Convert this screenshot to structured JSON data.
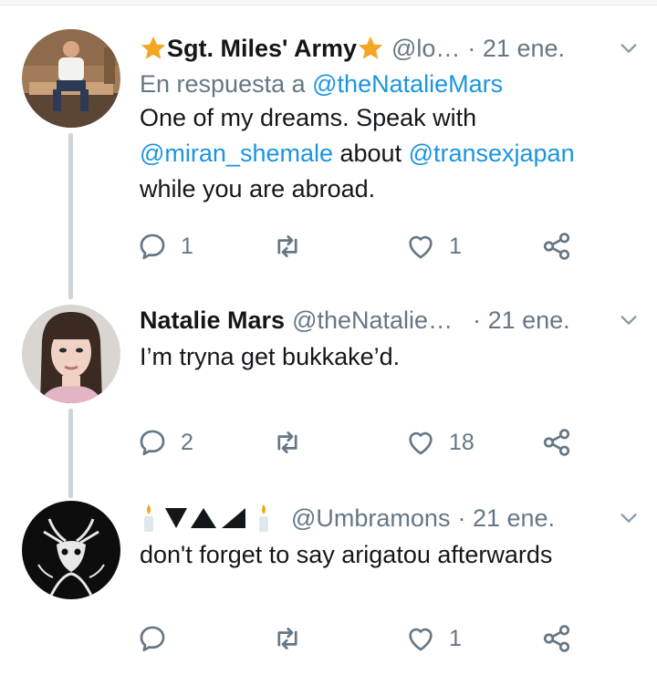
{
  "tweets": [
    {
      "display_name": "Sgt. Miles' Army",
      "handle": "@lo…",
      "time": "· 21 ene.",
      "reply_prefix": "En respuesta a",
      "reply_handle": "@theNatalieMars",
      "body": {
        "text1": "One of my dreams. Speak with",
        "mention1": "@miran_shemale",
        "text2": " about ",
        "mention2": "@transexjapan",
        "text3": "while you are abroad."
      },
      "replies": "1",
      "retweets": "",
      "likes": "1"
    },
    {
      "display_name": "Natalie Mars",
      "handle": "@theNatalie…",
      "time": "· 21 ene.",
      "body": {
        "text1": "I’m tryna get bukkake’d."
      },
      "replies": "2",
      "retweets": "",
      "likes": "18"
    },
    {
      "display_name": "",
      "handle": "@Umbramons",
      "time": "· 21 ene.",
      "body": {
        "text1": "don't forget to say arigatou afterwards"
      },
      "replies": "",
      "retweets": "",
      "likes": "1"
    }
  ],
  "colors": {
    "link": "#1b95e0",
    "muted": "#657786",
    "text": "#14171a",
    "thread_line": "#ccd6dd",
    "star": "#f5a623"
  },
  "icons": [
    "star-icon",
    "candle-icon",
    "reply-icon",
    "retweet-icon",
    "like-icon",
    "share-icon",
    "chevron-down-icon"
  ]
}
